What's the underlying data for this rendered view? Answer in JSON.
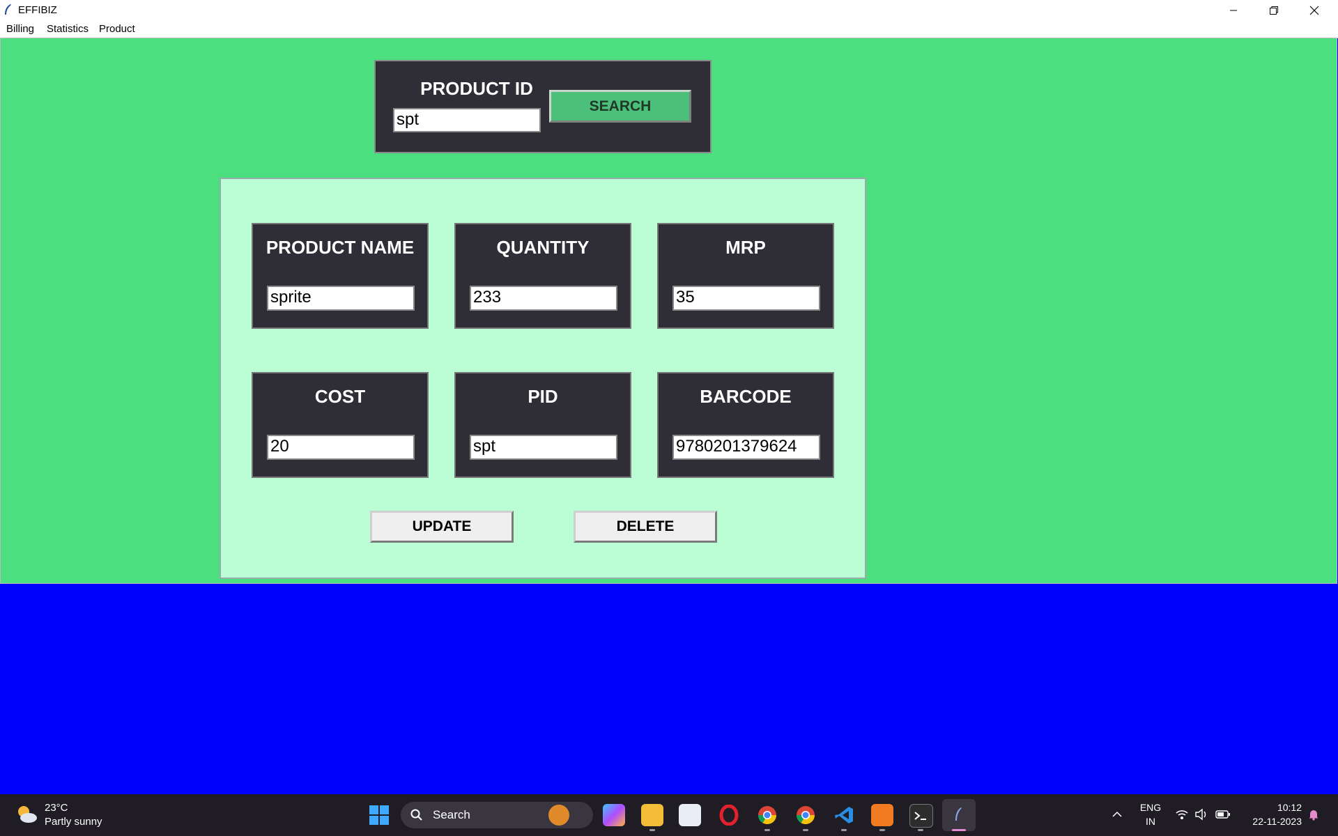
{
  "window": {
    "title": "EFFIBIZ"
  },
  "menu": {
    "items": [
      "Billing",
      "Statistics",
      "Product"
    ]
  },
  "search": {
    "label": "PRODUCT ID",
    "value": "spt",
    "button": "SEARCH"
  },
  "fields": {
    "name": {
      "label": "PRODUCT NAME",
      "value": "sprite"
    },
    "quantity": {
      "label": "QUANTITY",
      "value": "233"
    },
    "mrp": {
      "label": "MRP",
      "value": "35"
    },
    "cost": {
      "label": "COST",
      "value": "20"
    },
    "pid": {
      "label": "PID",
      "value": "spt"
    },
    "barcode": {
      "label": "BARCODE",
      "value": "9780201379624"
    }
  },
  "actions": {
    "update": "UPDATE",
    "delete": "DELETE"
  },
  "taskbar": {
    "weather_temp": "23°C",
    "weather_desc": "Partly sunny",
    "search_label": "Search",
    "lang_top": "ENG",
    "lang_bottom": "IN",
    "time": "10:12",
    "date": "22-11-2023"
  },
  "colors": {
    "form_bg": "#4cdf7f",
    "panel_bg": "#bbfdd5",
    "box_bg": "#2f2e36",
    "root_bg": "#0000fd"
  }
}
